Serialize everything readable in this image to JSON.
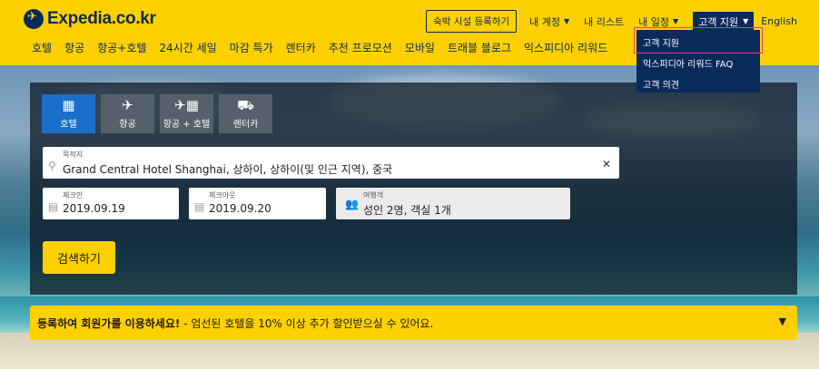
{
  "header": {
    "logo_text": "Expedia.co.kr",
    "register_button": "숙박 시설 등록하기",
    "my_account": "내 계정",
    "my_list": "내 리스트",
    "my_trips": "내 일정",
    "customer_support": "고객 지원",
    "language": "English"
  },
  "nav": {
    "items": [
      "호텔",
      "항공",
      "항공+호텔",
      "24시간 세일",
      "마감 특가",
      "렌터카",
      "추천 프로모션",
      "모바일",
      "트래블 블로그",
      "익스피디아 리워드"
    ]
  },
  "dropdown": {
    "items": [
      "고객 지원",
      "익스피디아 리워드 FAQ",
      "고객 의견"
    ]
  },
  "search": {
    "tabs": [
      {
        "label": "호텔",
        "icon": "building-icon"
      },
      {
        "label": "항공",
        "icon": "plane-icon"
      },
      {
        "label": "항공 + 호텔",
        "icon": "plane-building-icon"
      },
      {
        "label": "렌터카",
        "icon": "car-icon"
      }
    ],
    "destination_label": "목적지",
    "destination_value": "Grand Central Hotel Shanghai, 상하이, 상하이(및 인근 지역), 중국",
    "checkin_label": "체크인",
    "checkin_value": "2019.09.19",
    "checkout_label": "체크아웃",
    "checkout_value": "2019.09.20",
    "travelers_label": "여행객",
    "travelers_value": "성인 2명, 객실 1개",
    "search_button": "검색하기"
  },
  "promo": {
    "bold_text": "등록하여 회원가를 이용하세요!",
    "rest_text": " - 엄선된 호텔을 10% 이상 추가 할인받으실 수 있어요."
  },
  "colors": {
    "brand_yellow": "#fed000",
    "brand_navy": "#0a2a5c",
    "active_tab": "#1b6fcb",
    "highlight": "#e23c83"
  }
}
